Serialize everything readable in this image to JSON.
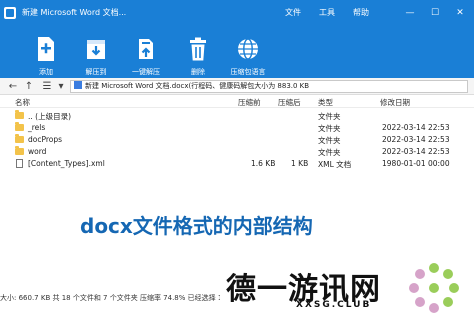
{
  "window": {
    "title": "新建 Microsoft Word 文档...",
    "menu": [
      "文件",
      "工具",
      "帮助"
    ],
    "controls": [
      "—",
      "☐",
      "✕"
    ]
  },
  "toolbar": {
    "items": [
      {
        "label": "添加",
        "icon": "add-icon"
      },
      {
        "label": "解压到",
        "icon": "extract-to-icon"
      },
      {
        "label": "一键解压",
        "icon": "one-click-extract-icon"
      },
      {
        "label": "删除",
        "icon": "trash-icon"
      },
      {
        "label": "压缩包语言",
        "icon": "globe-icon"
      }
    ]
  },
  "address": {
    "path": "新建 Microsoft Word 文档.docx(行程码、健康码解包大小为 883.0 KB"
  },
  "list": {
    "columns": [
      "名称",
      "压缩前",
      "压缩后",
      "类型",
      "修改日期"
    ],
    "rows": [
      {
        "name": ".. (上级目录)",
        "before": "",
        "after": "",
        "type": "文件夹",
        "date": "",
        "icon": "folder-icon"
      },
      {
        "name": "_rels",
        "before": "",
        "after": "",
        "type": "文件夹",
        "date": "2022-03-14 22:53",
        "icon": "folder-icon"
      },
      {
        "name": "docProps",
        "before": "",
        "after": "",
        "type": "文件夹",
        "date": "2022-03-14 22:53",
        "icon": "folder-icon"
      },
      {
        "name": "word",
        "before": "",
        "after": "",
        "type": "文件夹",
        "date": "2022-03-14 22:53",
        "icon": "folder-icon"
      },
      {
        "name": "[Content_Types].xml",
        "before": "1.6 KB",
        "after": "1 KB",
        "type": "XML 文档",
        "date": "1980-01-01 00:00",
        "icon": "file-icon"
      }
    ]
  },
  "caption": "docx文件格式的内部结构",
  "status": "大小: 660.7 KB 共 18 个文件和 7 个文件夹 压缩率 74.8% 已经选择 1",
  "brand": {
    "name": "德一游讯网",
    "url": "XXSG.CLUB"
  },
  "colors": {
    "primary": "#1a7fd6",
    "caption": "#1567b3",
    "folder": "#f3c34a"
  }
}
